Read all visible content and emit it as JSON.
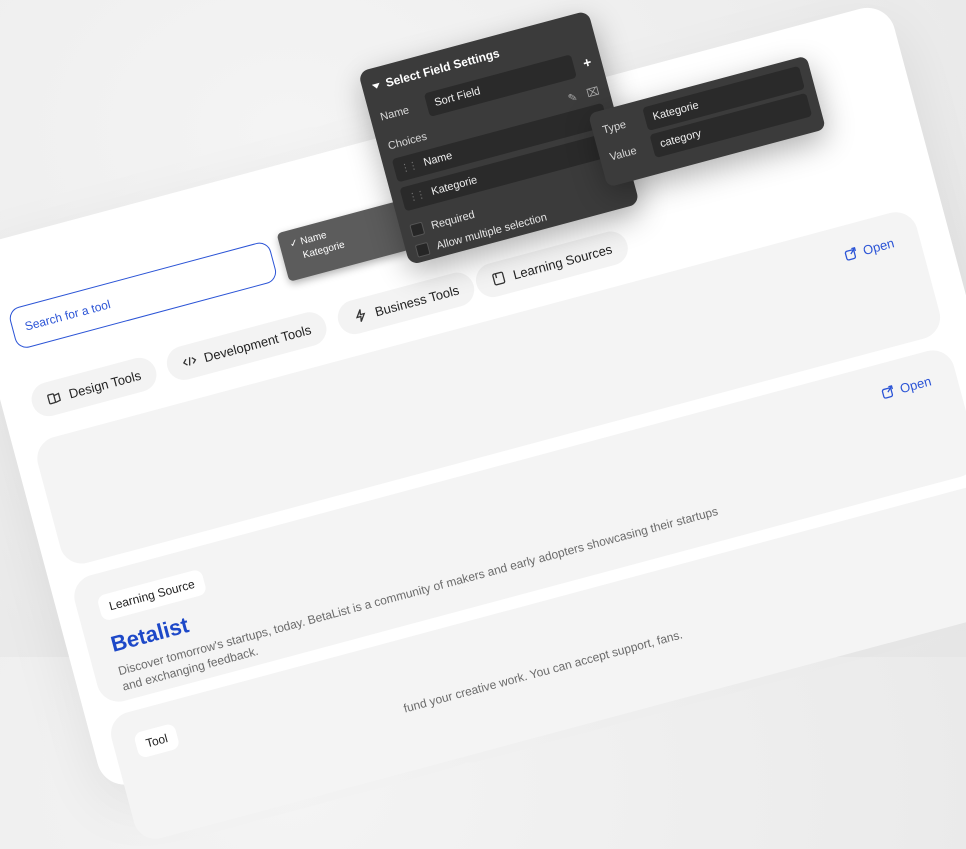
{
  "panel": {
    "title": "Select Field Settings",
    "name_label": "Name",
    "name_value": "Sort Field",
    "choices_label": "Choices",
    "choices": [
      "Name",
      "Kategorie"
    ],
    "required_label": "Required",
    "multiple_label": "Allow multiple selection"
  },
  "sub_panel": {
    "type_label": "Type",
    "type_value": "Kategorie",
    "value_label": "Value",
    "value_value": "category"
  },
  "search": {
    "placeholder": "Search for a tool"
  },
  "dropdown": {
    "options": [
      "✓ Name",
      "Kategorie"
    ]
  },
  "categories": [
    {
      "label": "Design Tools",
      "icon": "palette-icon"
    },
    {
      "label": "Development Tools",
      "icon": "code-icon"
    },
    {
      "label": "Business Tools",
      "icon": "bolt-icon"
    },
    {
      "label": "Learning Sources",
      "icon": "book-icon"
    }
  ],
  "open_label": "Open",
  "tools": [
    {
      "badge": "",
      "title": "",
      "description": ""
    },
    {
      "badge": "Learning Source",
      "title": "Betalist",
      "description": "Discover tomorrow's startups, today. BetaList is a community of makers and early adopters showcasing their startups and exchanging feedback."
    },
    {
      "badge": "Tool",
      "title": "",
      "description": "fund your creative work. You can accept support, fans."
    }
  ],
  "colors": {
    "accent": "#2b54d6",
    "title": "#1d48c8",
    "panel": "#3b3b3b"
  }
}
